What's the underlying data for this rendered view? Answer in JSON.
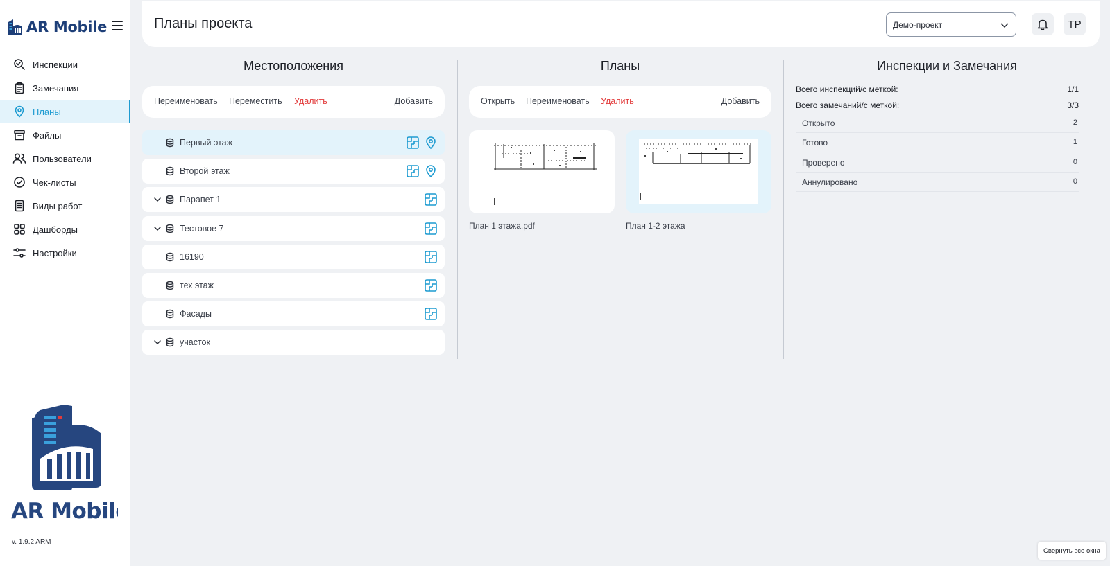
{
  "app": {
    "brand": "AR Mobile",
    "version": "v. 1.9.2 ARM"
  },
  "sidebar": {
    "items": [
      {
        "label": "Инспекции",
        "icon": "inspection-search-icon"
      },
      {
        "label": "Замечания",
        "icon": "clipboard-icon"
      },
      {
        "label": "Планы",
        "icon": "map-pin-icon",
        "active": true
      },
      {
        "label": "Файлы",
        "icon": "archive-box-icon"
      },
      {
        "label": "Пользователи",
        "icon": "users-icon"
      },
      {
        "label": "Чек-листы",
        "icon": "check-circle-icon"
      },
      {
        "label": "Виды работ",
        "icon": "document-list-icon"
      },
      {
        "label": "Дашборды",
        "icon": "dashboard-grid-icon"
      },
      {
        "label": "Настройки",
        "icon": "sliders-icon"
      }
    ]
  },
  "header": {
    "title": "Планы проекта",
    "project": "Демо-проект",
    "avatar_initials": "TP"
  },
  "locations": {
    "title": "Местоположения",
    "actions": {
      "rename": "Переименовать",
      "move": "Переместить",
      "delete": "Удалить",
      "add": "Добавить"
    },
    "items": [
      {
        "name": "Первый этаж",
        "expandable": false,
        "has_plan": true,
        "has_pin": true,
        "selected": true
      },
      {
        "name": "Второй этаж",
        "expandable": false,
        "has_plan": true,
        "has_pin": true
      },
      {
        "name": "Парапет 1",
        "expandable": true,
        "has_plan": true,
        "has_pin": false
      },
      {
        "name": "Тестовое 7",
        "expandable": true,
        "has_plan": true,
        "has_pin": false
      },
      {
        "name": "16190",
        "expandable": false,
        "has_plan": true,
        "has_pin": false
      },
      {
        "name": "тех этаж",
        "expandable": false,
        "has_plan": true,
        "has_pin": false
      },
      {
        "name": "Фасады",
        "expandable": false,
        "has_plan": true,
        "has_pin": false
      },
      {
        "name": "участок",
        "expandable": true,
        "has_plan": false,
        "has_pin": false
      }
    ]
  },
  "plans": {
    "title": "Планы",
    "actions": {
      "open": "Открыть",
      "rename": "Переименовать",
      "delete": "Удалить",
      "add": "Добавить"
    },
    "items": [
      {
        "name": "План 1 этажа.pdf",
        "selected": false
      },
      {
        "name": "План 1-2 этажа",
        "selected": true
      }
    ]
  },
  "stats": {
    "title": "Инспекции и Замечания",
    "inspections_label": "Всего инспекций/с меткой:",
    "inspections_value": "1/1",
    "remarks_label": "Всего замечаний/с меткой:",
    "remarks_value": "3/3",
    "breakdown": [
      {
        "label": "Открыто",
        "value": "2"
      },
      {
        "label": "Готово",
        "value": "1"
      },
      {
        "label": "Проверено",
        "value": "0"
      },
      {
        "label": "Аннулировано",
        "value": "0"
      }
    ]
  },
  "footer": {
    "collapse_all": "Свернуть все окна"
  },
  "colors": {
    "brand": "#1e3f78",
    "accent": "#1d9bd1",
    "danger": "#e23b3b",
    "background": "#eff1f4"
  }
}
